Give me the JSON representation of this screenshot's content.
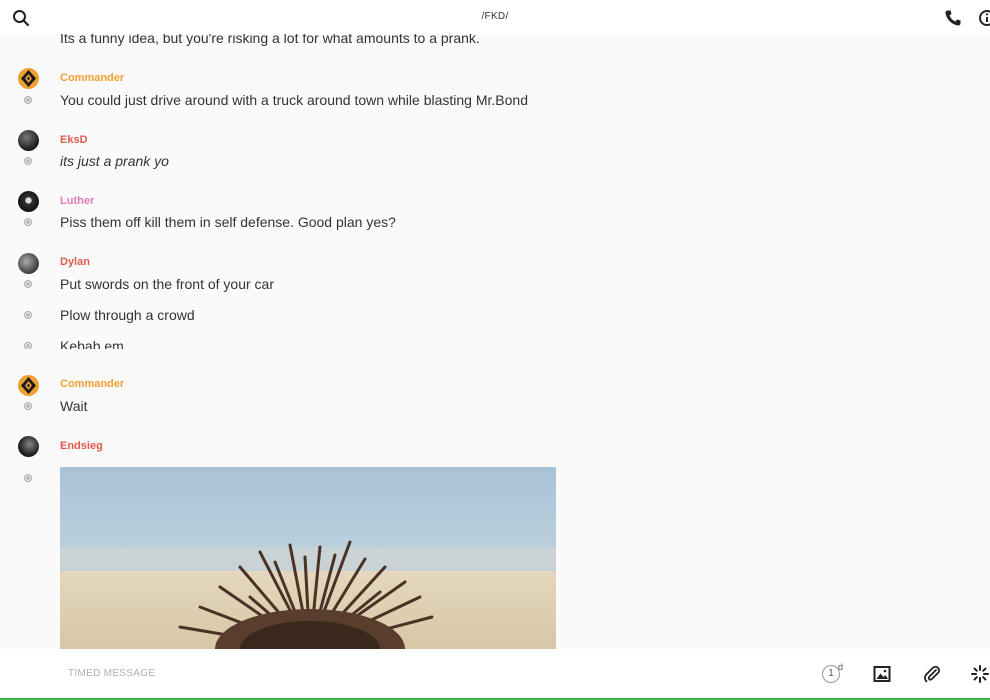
{
  "header": {
    "title": "/FKD/"
  },
  "icons": {
    "search": "search-icon",
    "phone": "phone-icon",
    "info": "info-icon"
  },
  "messages": {
    "m0": {
      "text": "Its a funny idea, but you're risking a lot for what amounts to a prank."
    },
    "g1": {
      "author": "Commander",
      "author_color": "#f0a030",
      "text": "You could just drive around with a truck around town while blasting Mr.Bond"
    },
    "g2": {
      "author": "EksD",
      "author_color": "#e05a4e",
      "text": "its just a prank yo"
    },
    "g3": {
      "author": "Luther",
      "author_color": "#e07ab8",
      "text": "Piss them off kill them in self defense. Good plan yes?"
    },
    "g4": {
      "author": "Dylan",
      "author_color": "#e05a4e",
      "texts": [
        "Put swords on the front of your car",
        "Plow through a crowd",
        "Kebab em"
      ]
    },
    "g5": {
      "author": "Commander",
      "author_color": "#f0a030",
      "text": "Wait"
    },
    "g6": {
      "author": "Endsieg",
      "author_color": "#e05a4e",
      "attachment": "image"
    }
  },
  "composer": {
    "placeholder": "TIMED MESSAGE",
    "timer_value": "1",
    "timer_unit": "d",
    "icons": [
      "image-icon",
      "paperclip-icon",
      "sparkle-icon"
    ]
  },
  "colors": {
    "accent_green": "#3fb24a"
  }
}
